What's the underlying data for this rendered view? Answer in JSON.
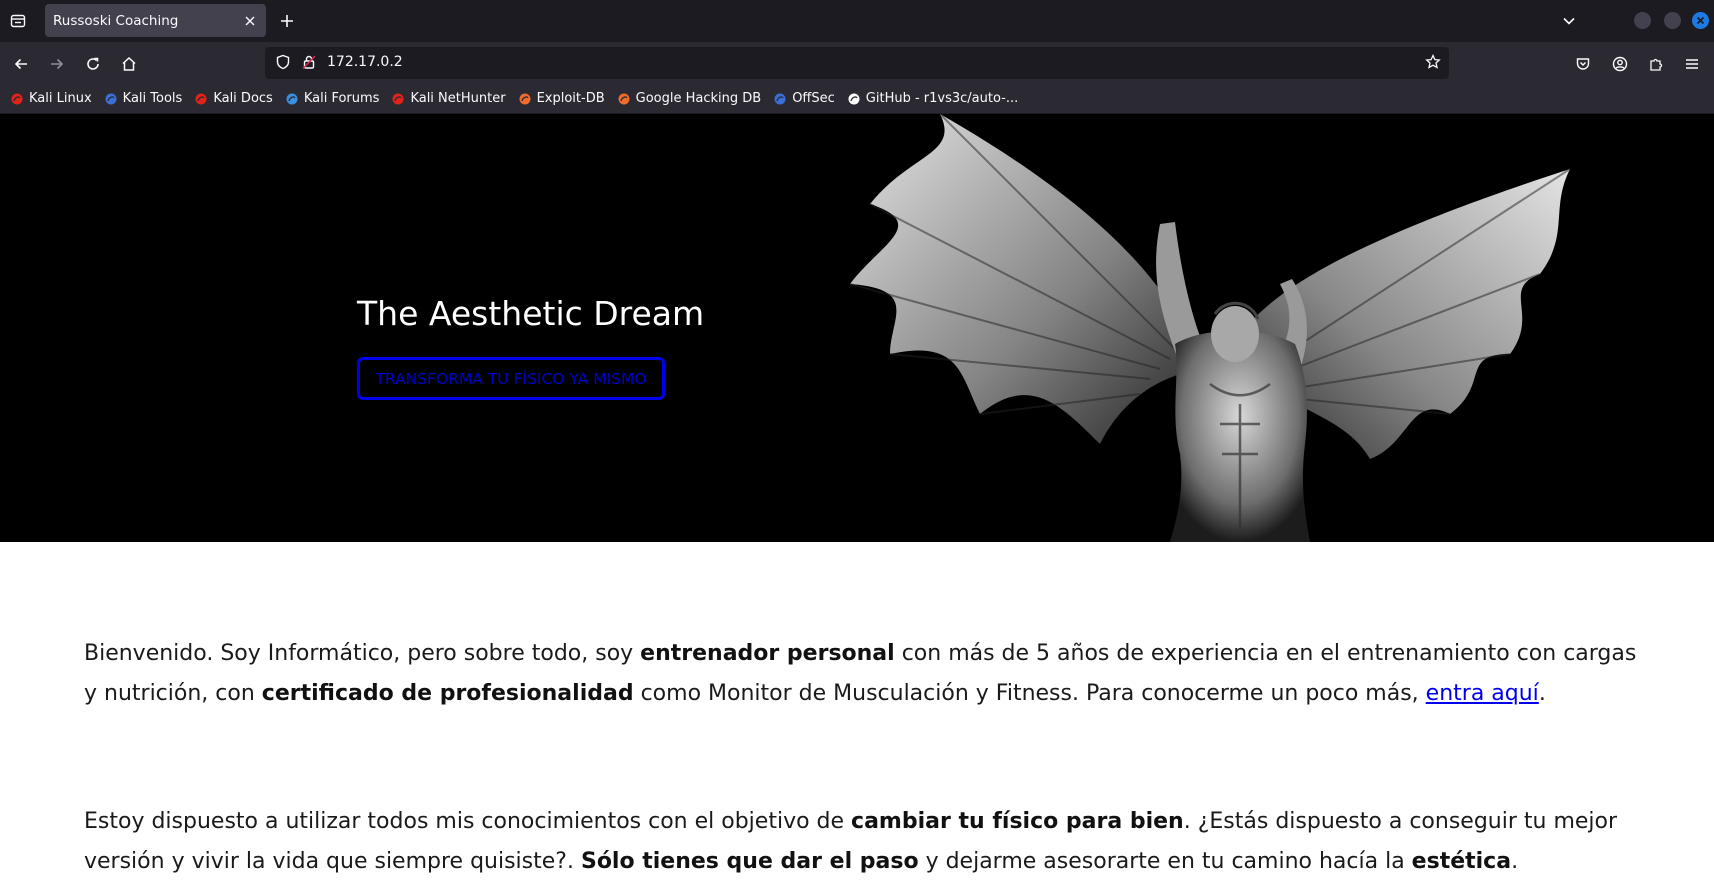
{
  "browser": {
    "tab": {
      "title": "Russoski Coaching"
    },
    "url": "172.17.0.2",
    "bookmarks": [
      {
        "label": "Kali Linux",
        "icon": "kali-icon",
        "color": "#e2231a"
      },
      {
        "label": "Kali Tools",
        "icon": "kali-tools-icon",
        "color": "#3b6fd6"
      },
      {
        "label": "Kali Docs",
        "icon": "kali-docs-icon",
        "color": "#e2231a"
      },
      {
        "label": "Kali Forums",
        "icon": "kali-forums-icon",
        "color": "#3b8fe0"
      },
      {
        "label": "Kali NetHunter",
        "icon": "kali-nethunter-icon",
        "color": "#e2231a"
      },
      {
        "label": "Exploit-DB",
        "icon": "exploit-db-icon",
        "color": "#f16b2a"
      },
      {
        "label": "Google Hacking DB",
        "icon": "ghdb-icon",
        "color": "#f16b2a"
      },
      {
        "label": "OffSec",
        "icon": "offsec-icon",
        "color": "#3b6fd6"
      },
      {
        "label": "GitHub - r1vs3c/auto-...",
        "icon": "github-icon",
        "color": "#ffffff"
      }
    ]
  },
  "hero": {
    "title": "The Aesthetic Dream",
    "cta_label": "TRANSFORMA TU FÍSICO YA MISMO",
    "accent": "#0000ee"
  },
  "content": {
    "p1": {
      "t1": "Bienvenido. Soy Informático, pero sobre todo, soy ",
      "b1": "entrenador personal",
      "t2": " con más de 5 años de experiencia en el entrenamiento con cargas y nutrición, con ",
      "b2": "certificado de profesionalidad",
      "t3": " como Monitor de Musculación y Fitness. Para conocerme un poco más, ",
      "link": "entra aquí",
      "t4": "."
    },
    "p2": {
      "t1": "Estoy dispuesto a utilizar todos mis conocimientos con el objetivo de ",
      "b1": "cambiar tu físico para bien",
      "t2": ". ¿Estás dispuesto a conseguir tu mejor versión y vivir la vida que siempre quisiste?. ",
      "b2": "Sólo tienes que dar el paso",
      "t3": " y dejarme asesorarte en tu camino hacía la ",
      "b3": "estética",
      "t4": "."
    }
  }
}
